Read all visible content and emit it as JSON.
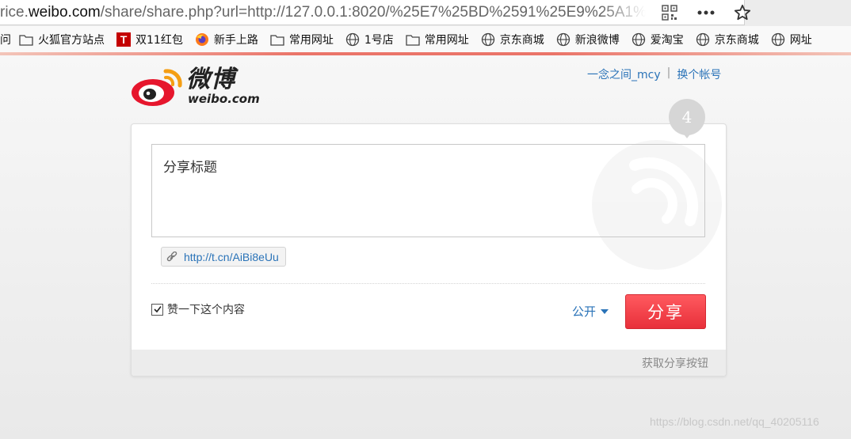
{
  "browser": {
    "url_prefix": "rice.",
    "url_host": "weibo.com",
    "url_rest": "/share/share.php?url=http://127.0.0.1:8020/%25E7%25BD%2591%25E9%25A1%25",
    "bookmarks": [
      {
        "label": "问",
        "icon": "none"
      },
      {
        "label": "火狐官方站点",
        "icon": "folder-icon"
      },
      {
        "label": "双11红包",
        "icon": "tmall-icon"
      },
      {
        "label": "新手上路",
        "icon": "firefox-icon"
      },
      {
        "label": "常用网址",
        "icon": "folder-icon"
      },
      {
        "label": "1号店",
        "icon": "globe-icon"
      },
      {
        "label": "常用网址",
        "icon": "folder-icon"
      },
      {
        "label": "京东商城",
        "icon": "globe-icon"
      },
      {
        "label": "新浪微博",
        "icon": "globe-icon"
      },
      {
        "label": "爱淘宝",
        "icon": "globe-icon"
      },
      {
        "label": "京东商城",
        "icon": "globe-icon"
      },
      {
        "label": "网址",
        "icon": "globe-icon"
      }
    ]
  },
  "header": {
    "logo_cn": "微博",
    "logo_en": "weibo.com",
    "username": "一念之间_mcy",
    "separator": "|",
    "switch_account": "换个帐号"
  },
  "share": {
    "count": "4",
    "text": "分享标题",
    "short_url": "http://t.cn/AiBi8eUu",
    "like_label": "赞一下这个内容",
    "like_checked": true,
    "privacy": "公开",
    "share_button": "分享",
    "footer_link": "获取分享按钮"
  },
  "watermark_text": "https://blog.csdn.net/qq_40205116",
  "colors": {
    "link": "#2a73b8",
    "share_button": "#e8303a",
    "accent_line": "#e94c3d"
  }
}
